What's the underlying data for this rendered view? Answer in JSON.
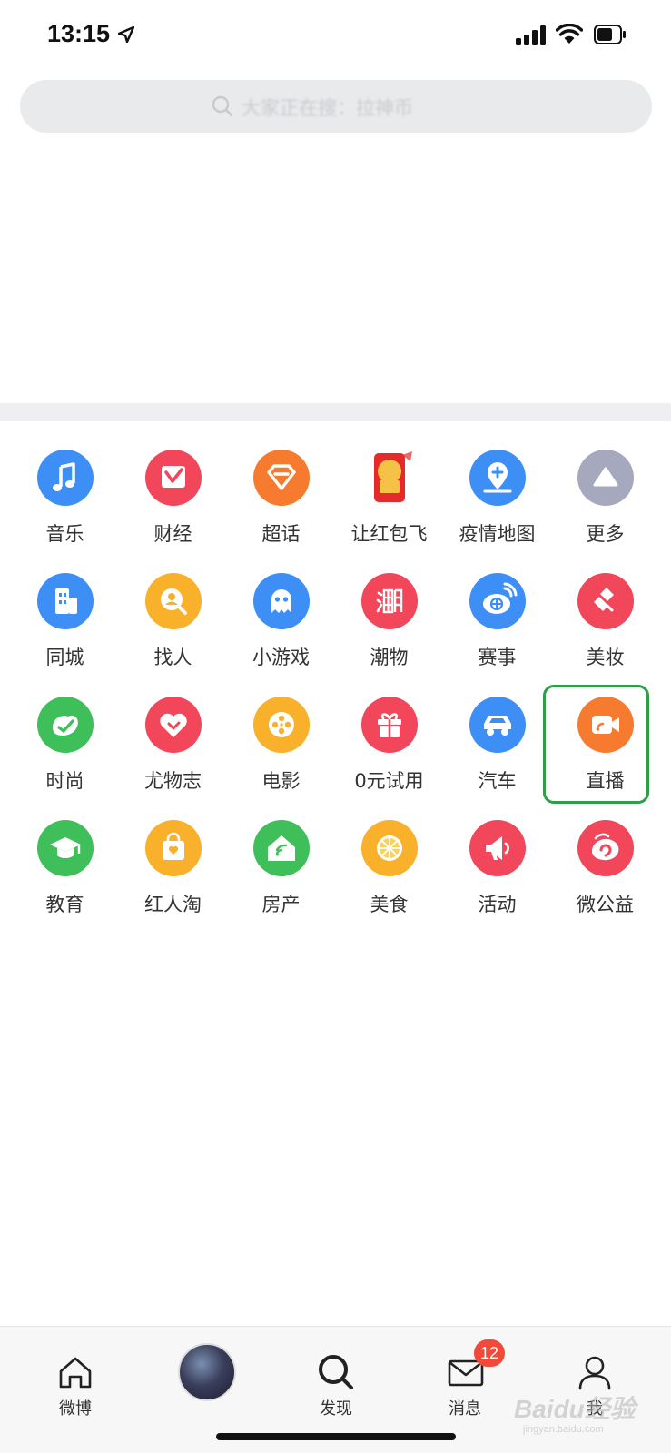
{
  "status_bar": {
    "time": "13:15"
  },
  "search": {
    "placeholder": "大家正在搜：拉神币"
  },
  "grid": {
    "items": [
      {
        "label": "音乐",
        "icon": "music-note-icon",
        "color": "#3d8ff5"
      },
      {
        "label": "财经",
        "icon": "finance-icon",
        "color": "#f2465a"
      },
      {
        "label": "超话",
        "icon": "diamond-icon",
        "color": "#f77b2e"
      },
      {
        "label": "让红包飞",
        "icon": "red-envelope-icon",
        "color": "#e52a2a"
      },
      {
        "label": "疫情地图",
        "icon": "map-pin-icon",
        "color": "#3d8ff5"
      },
      {
        "label": "更多",
        "icon": "triangle-up-icon",
        "color": "#a6a8bd"
      },
      {
        "label": "同城",
        "icon": "building-icon",
        "color": "#3d8ff5"
      },
      {
        "label": "找人",
        "icon": "person-search-icon",
        "color": "#f9b02a"
      },
      {
        "label": "小游戏",
        "icon": "ghost-icon",
        "color": "#3d8ff5"
      },
      {
        "label": "潮物",
        "icon": "chao-text-icon",
        "color": "#f2465a"
      },
      {
        "label": "赛事",
        "icon": "basketball-icon",
        "color": "#3d8ff5"
      },
      {
        "label": "美妆",
        "icon": "lipstick-icon",
        "color": "#f2465a"
      },
      {
        "label": "时尚",
        "icon": "heart-leaf-icon",
        "color": "#3fbf5a"
      },
      {
        "label": "尤物志",
        "icon": "heart-icon",
        "color": "#f2465a"
      },
      {
        "label": "电影",
        "icon": "film-reel-icon",
        "color": "#f9b02a"
      },
      {
        "label": "0元试用",
        "icon": "gift-icon",
        "color": "#f2465a"
      },
      {
        "label": "汽车",
        "icon": "car-icon",
        "color": "#3d8ff5"
      },
      {
        "label": "直播",
        "icon": "video-camera-icon",
        "color": "#f77b2e"
      },
      {
        "label": "教育",
        "icon": "graduation-cap-icon",
        "color": "#3fbf5a"
      },
      {
        "label": "红人淘",
        "icon": "shopping-bag-icon",
        "color": "#f9b02a"
      },
      {
        "label": "房产",
        "icon": "house-icon",
        "color": "#3fbf5a"
      },
      {
        "label": "美食",
        "icon": "lemon-slice-icon",
        "color": "#f9b02a"
      },
      {
        "label": "活动",
        "icon": "megaphone-icon",
        "color": "#f2465a"
      },
      {
        "label": "微公益",
        "icon": "charity-icon",
        "color": "#f2465a"
      }
    ]
  },
  "tab_bar": {
    "home": "微博",
    "discover": "发现",
    "messages": "消息",
    "messages_badge": "12",
    "me": "我"
  },
  "watermark": {
    "main": "Baidu经验",
    "sub": "jingyan.baidu.com"
  }
}
